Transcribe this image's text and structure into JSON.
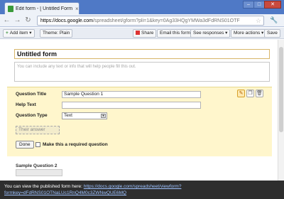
{
  "browser": {
    "tab_title": "Edit form - [ Untitled Form",
    "url_host": "https://docs.google.com",
    "url_path": "/spreadsheet/gform?pli=1&key=0Ag33HQgYMWa3dFdRNS01OTF",
    "controls": {
      "minimize": "–",
      "maximize": "□",
      "close": "✕"
    },
    "icons": [
      "back-icon",
      "forward-icon",
      "reload-icon",
      "home-icon",
      "star-icon",
      "wrench-icon"
    ]
  },
  "toolbar": {
    "add_item": "Add item",
    "theme": "Theme: Plain",
    "share": "Share",
    "email": "Email this form",
    "see_responses": "See responses",
    "more_actions": "More actions",
    "save": "Save"
  },
  "form": {
    "title": "Untitled form",
    "description_placeholder": "You can include any text or info that will help people fill this out."
  },
  "question": {
    "title_label": "Question Title",
    "title_value": "Sample Question 1",
    "help_label": "Help Text",
    "help_value": "",
    "type_label": "Question Type",
    "type_value": "Text",
    "answer_placeholder": "Their answer",
    "done": "Done",
    "required_label": "Make this a required question"
  },
  "question2": {
    "title": "Sample Question 2"
  },
  "notice": {
    "text": "You can view the published form here:",
    "link": "https://docs.google.com/spreadsheet/viewform?formkey=dFdRNS01OTNaLUc1RnQ4M0c3ZWNwQUE6MQ"
  },
  "colors": {
    "accent": "#4f79c6",
    "question_bg": "#fff6cc",
    "notice_bg": "#2e2e2e"
  }
}
